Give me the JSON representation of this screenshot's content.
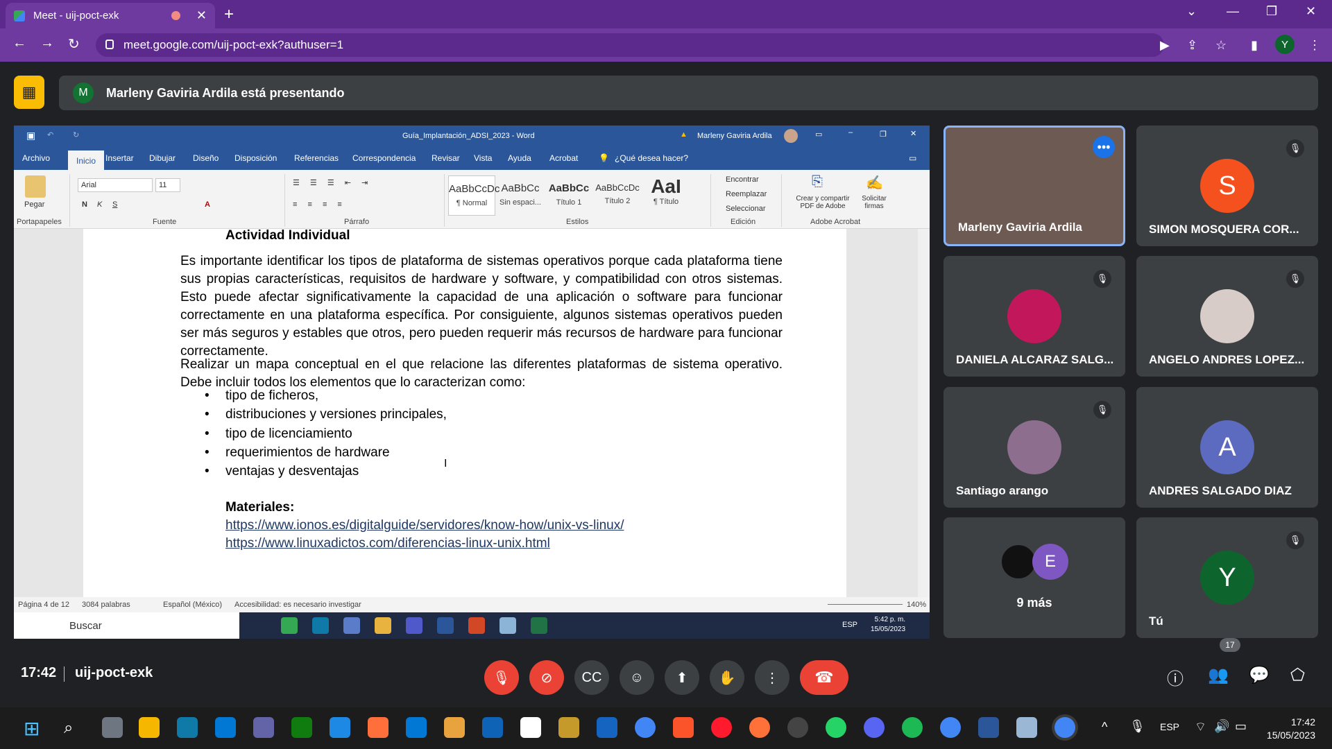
{
  "browser": {
    "tab_title": "Meet - uij-poct-exk",
    "url": "meet.google.com/uij-poct-exk?authuser=1",
    "profile_initial": "Y"
  },
  "meet": {
    "presenting_initial": "M",
    "presenting_text": "Marleny Gaviria Ardila está presentando",
    "clock": "17:42",
    "meeting_code": "uij-poct-exk",
    "people_count": "17"
  },
  "word": {
    "doc_title": "Guía_Implantación_ADSI_2023  -  Word",
    "user": "Marleny Gaviria Ardila",
    "tabs": [
      "Archivo",
      "Inicio",
      "Insertar",
      "Dibujar",
      "Diseño",
      "Disposición",
      "Referencias",
      "Correspondencia",
      "Revisar",
      "Vista",
      "Ayuda",
      "Acrobat"
    ],
    "tell_me": "¿Qué desea hacer?",
    "font": "Arial",
    "size": "11",
    "groups": {
      "clipboard": "Portapapeles",
      "font": "Fuente",
      "paragraph": "Párrafo",
      "styles": "Estilos",
      "editing": "Edición",
      "acrobat": "Adobe Acrobat"
    },
    "paste": "Pegar",
    "styles": [
      {
        "sample": "AaBbCcDc",
        "name": "¶ Normal"
      },
      {
        "sample": "AaBbCc",
        "name": "Sin espaci..."
      },
      {
        "sample": "AaBbCc",
        "name": "Título 1"
      },
      {
        "sample": "AaBbCcDc",
        "name": "Título 2"
      },
      {
        "sample": "AaI",
        "name": "¶ Título"
      }
    ],
    "editing": {
      "find": "Encontrar",
      "replace": "Reemplazar",
      "select": "Seleccionar"
    },
    "acrobat": {
      "create": "Crear y compartir PDF de Adobe",
      "sign": "Solicitar firmas"
    },
    "doc": {
      "heading": "Actividad Individual",
      "para1": "Es importante identificar los tipos de plataforma de sistemas operativos porque cada plataforma tiene sus propias características, requisitos de hardware y software, y compatibilidad con otros sistemas. Esto puede afectar significativamente la capacidad de una aplicación o software para funcionar correctamente en una plataforma específica. Por consiguiente, algunos sistemas operativos pueden ser más seguros y estables que otros, pero pueden requerir más recursos de hardware para funcionar correctamente.",
      "para2": "Realizar un mapa conceptual en el que relacione las diferentes plataformas de sistema operativo. Debe incluir todos los elementos que lo caracterizan como:",
      "bullets": [
        "tipo de ficheros,",
        "distribuciones y versiones principales,",
        "tipo de licenciamiento",
        "requerimientos de hardware",
        "ventajas y desventajas"
      ],
      "materials_label": "Materiales:",
      "links": [
        "https://www.ionos.es/digitalguide/servidores/know-how/unix-vs-linux/",
        "https://www.linuxadictos.com/diferencias-linux-unix.html"
      ]
    },
    "status": {
      "page": "Página 4 de 12",
      "words": "3084 palabras",
      "lang": "Español (México)",
      "access": "Accesibilidad: es necesario investigar",
      "zoom": "140%"
    },
    "taskbar": {
      "search": "Buscar",
      "time": "5:42 p. m.",
      "date": "15/05/2023",
      "lang": "ESP"
    }
  },
  "participants": [
    {
      "name": "Marleny Gaviria Ardila",
      "initial": "",
      "color": "#6d5a52"
    },
    {
      "name": "SIMON MOSQUERA COR...",
      "initial": "S",
      "color": "#f4511e"
    },
    {
      "name": "DANIELA ALCARAZ SALG...",
      "initial": "",
      "color": "#c2185b"
    },
    {
      "name": "ANGELO ANDRES LOPEZ...",
      "initial": "",
      "color": "#d7ccc8"
    },
    {
      "name": "Santiago arango",
      "initial": "",
      "color": "#8e6e8e"
    },
    {
      "name": "ANDRES SALGADO DIAZ",
      "initial": "A",
      "color": "#5c6bc0"
    },
    {
      "name": "9 más",
      "initial": "E",
      "color": "#7e57c2"
    },
    {
      "name": "Tú",
      "initial": "Y",
      "color": "#0d652d"
    }
  ],
  "os": {
    "time": "17:42",
    "date": "15/05/2023",
    "lang": "ESP"
  },
  "colors": {
    "accent": "#6e3aa0",
    "word_blue": "#2b579a",
    "end_call": "#ea4335"
  }
}
